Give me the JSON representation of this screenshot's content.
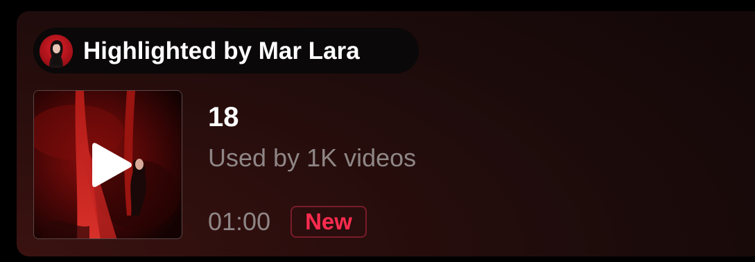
{
  "highlight": {
    "label": "Highlighted by Mar Lara",
    "avatar_icon": "user-avatar-icon"
  },
  "track": {
    "title": "18",
    "usage": "Used by 1K videos",
    "duration": "01:00",
    "badge": "New",
    "play_icon": "play-icon"
  },
  "colors": {
    "badge_text": "#ff2b4f",
    "badge_border": "#7a1c2a",
    "secondary_text": "#8f8686",
    "primary_text": "#ffffff"
  }
}
